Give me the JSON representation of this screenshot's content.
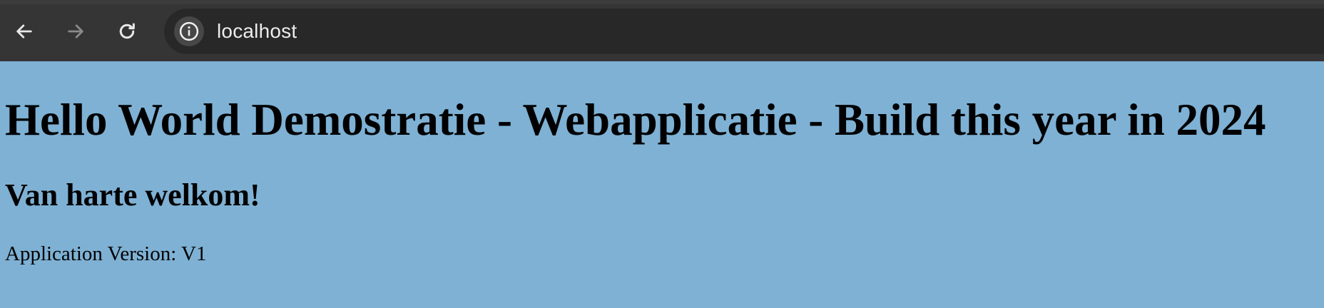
{
  "browser": {
    "url": "localhost",
    "icons": {
      "back": "back-arrow-icon",
      "forward": "forward-arrow-icon",
      "reload": "reload-icon",
      "site_info": "info-icon"
    },
    "forward_enabled": false
  },
  "page": {
    "background_color": "#7eb1d4",
    "title": "Hello World Demostratie - Webapplicatie - Build this year in 2024",
    "subtitle": "Van harte welkom!",
    "version_label": "Application Version: ",
    "version_value": "V1"
  }
}
